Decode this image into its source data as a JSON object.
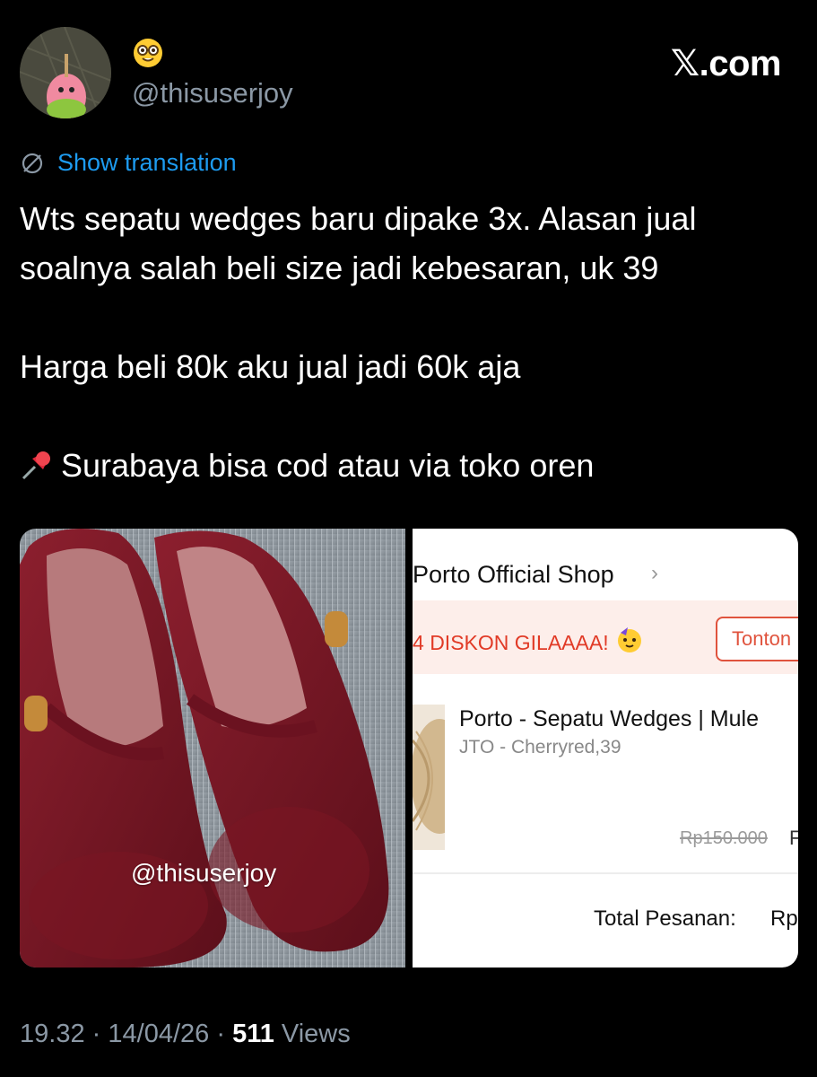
{
  "profile": {
    "handle": "@thisuserjoy",
    "badge_emoji": "nerd-face-emoji"
  },
  "brand": {
    "text": "𝕏.com"
  },
  "translation": {
    "label": "Show translation",
    "icon": "translate-globe-icon"
  },
  "tweet": {
    "paragraph1": "Wts sepatu wedges baru dipake 3x. Alasan jual soalnya salah beli size jadi kebesaran, uk 39",
    "paragraph2": "Harga beli 80k aku jual jadi 60k aja",
    "paragraph3": "Surabaya bisa cod atau via toko oren",
    "pin_icon": "pushpin-icon"
  },
  "media": {
    "left_photo": {
      "watermark": "@thisuserjoy",
      "subject": "red-mary-jane-shoes-photo"
    },
    "right_screenshot": {
      "shop_name": "Porto Official Shop",
      "chevron": "›",
      "promo_text": "DISKON GILAAAA!",
      "promo_prefix": "4",
      "promo_icon": "partying-face-emoji",
      "tonton_label": "Tonton",
      "product_name": "Porto - Sepatu Wedges | Mule",
      "variant": "JTO - Cherryred,39",
      "old_price": "Rp150.000",
      "old_price_tail": "F",
      "total_label": "Total Pesanan:",
      "total_tail": "Rp"
    }
  },
  "meta": {
    "time": "19.32",
    "date": "14/04/26",
    "separator": "·",
    "views_count": "511",
    "views_label": "Views"
  },
  "colors": {
    "background": "#000000",
    "text": "#ffffff",
    "muted": "#8b98a5",
    "link": "#1d9bf0",
    "promo_red": "#e13a26"
  }
}
